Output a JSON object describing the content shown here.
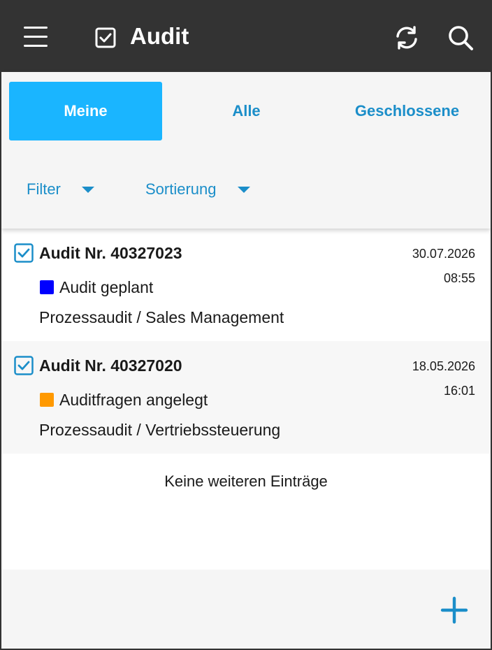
{
  "appbar": {
    "title": "Audit",
    "icons": {
      "menu": "menu-icon",
      "title": "checkbox-icon",
      "refresh": "refresh-icon",
      "search": "search-icon"
    }
  },
  "tabs": [
    {
      "label": "Meine",
      "active": true
    },
    {
      "label": "Alle",
      "active": false
    },
    {
      "label": "Geschlossene",
      "active": false
    }
  ],
  "filters": {
    "filter_label": "Filter",
    "sort_label": "Sortierung"
  },
  "audits": [
    {
      "name": "Audit Nr. 40327023",
      "date": "30.07.2026",
      "time": "08:55",
      "status": "Audit geplant",
      "status_color": "#0000ff",
      "description": "Prozessaudit / Sales Management"
    },
    {
      "name": "Audit Nr. 40327020",
      "date": "18.05.2026",
      "time": "16:01",
      "status": "Auditfragen angelegt",
      "status_color": "#ff9900",
      "description": "Prozessaudit / Vertriebssteuerung"
    }
  ],
  "empty_text": "Keine weiteren Einträge",
  "colors": {
    "appbar": "#333333",
    "accent": "#1ab5ff",
    "link": "#1b8ec9"
  },
  "fab_icon": "plus-icon"
}
